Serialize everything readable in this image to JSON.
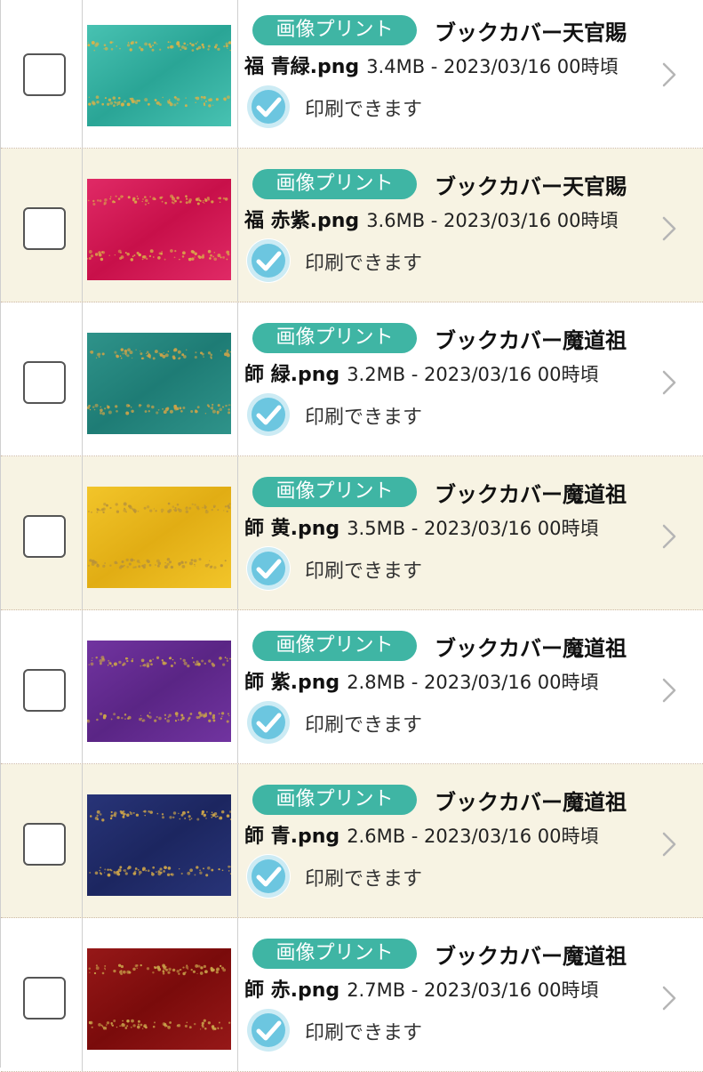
{
  "items": [
    {
      "badge": "画像プリント",
      "title": "ブックカバー天官賜",
      "filename": "福 青緑.png",
      "meta": "3.4MB - 2023/03/16 00時頃",
      "status": "印刷できます",
      "thumb_color": "#2aa596",
      "thumb_color2": "#48c2b2",
      "band_color": "#d9b24a",
      "bg": "white"
    },
    {
      "badge": "画像プリント",
      "title": "ブックカバー天官賜",
      "filename": "福 赤紫.png",
      "meta": "3.6MB - 2023/03/16 00時頃",
      "status": "印刷できます",
      "thumb_color": "#c8104a",
      "thumb_color2": "#e02a66",
      "band_color": "#d9a94a",
      "bg": "alt"
    },
    {
      "badge": "画像プリント",
      "title": "ブックカバー魔道祖",
      "filename": "師 緑.png",
      "meta": "3.2MB - 2023/03/16 00時頃",
      "status": "印刷できます",
      "thumb_color": "#1e7c75",
      "thumb_color2": "#2f938a",
      "band_color": "#c9a24a",
      "bg": "white"
    },
    {
      "badge": "画像プリント",
      "title": "ブックカバー魔道祖",
      "filename": "師 黄.png",
      "meta": "3.5MB - 2023/03/16 00時頃",
      "status": "印刷できます",
      "thumb_color": "#e1ad14",
      "thumb_color2": "#f2c52a",
      "band_color": "#b8923a",
      "bg": "alt"
    },
    {
      "badge": "画像プリント",
      "title": "ブックカバー魔道祖",
      "filename": "師 紫.png",
      "meta": "2.8MB - 2023/03/16 00時頃",
      "status": "印刷できます",
      "thumb_color": "#5a2585",
      "thumb_color2": "#7134a0",
      "band_color": "#c9a24a",
      "bg": "white"
    },
    {
      "badge": "画像プリント",
      "title": "ブックカバー魔道祖",
      "filename": "師 青.png",
      "meta": "2.6MB - 2023/03/16 00時頃",
      "status": "印刷できます",
      "thumb_color": "#1c2660",
      "thumb_color2": "#283478",
      "band_color": "#c9a24a",
      "bg": "alt"
    },
    {
      "badge": "画像プリント",
      "title": "ブックカバー魔道祖",
      "filename": "師 赤.png",
      "meta": "2.7MB - 2023/03/16 00時頃",
      "status": "印刷できます",
      "thumb_color": "#7a0b0b",
      "thumb_color2": "#961818",
      "band_color": "#c9a24a",
      "bg": "white"
    }
  ],
  "colors": {
    "badge": "#3fb5a4",
    "check_icon": "#6cc6e0",
    "alt_row": "#f7f3e3",
    "divider": "#cdb9a5"
  },
  "icons": {
    "row_icon": "check-circle-icon",
    "nav_icon": "chevron-right-icon",
    "select_icon": "checkbox-unchecked-icon"
  }
}
